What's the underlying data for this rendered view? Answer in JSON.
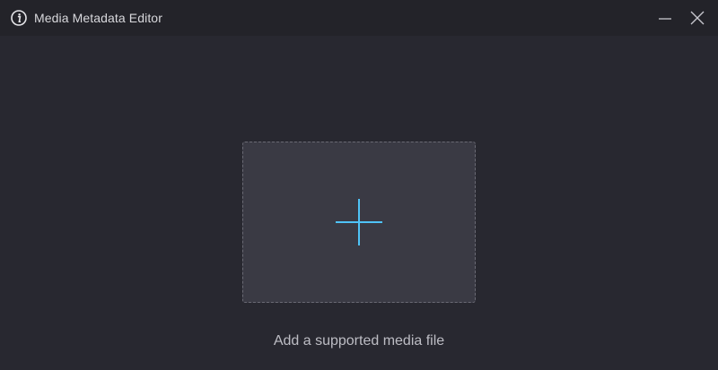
{
  "window": {
    "title": "Media Metadata Editor",
    "icon": "info-icon",
    "controls": {
      "minimize_icon": "minimize-icon",
      "close_icon": "close-icon"
    }
  },
  "dropzone": {
    "icon": "plus-icon",
    "hint": "Add a supported media file"
  },
  "colors": {
    "background": "#282830",
    "titlebar": "#232329",
    "dropzone_fill": "#3a3a44",
    "accent": "#4fc3f7"
  }
}
